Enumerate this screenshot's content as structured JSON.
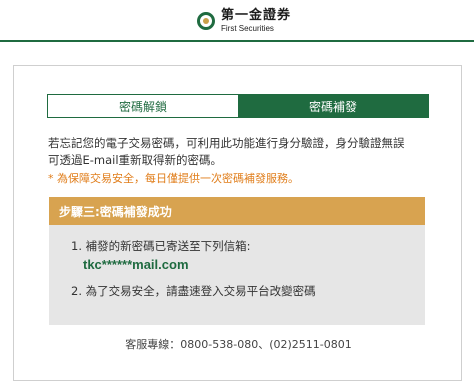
{
  "header": {
    "logo_cn": "第一金證券",
    "logo_en": "First Securities"
  },
  "tabs": [
    {
      "label": "密碼解鎖",
      "active": false
    },
    {
      "label": "密碼補發",
      "active": true
    }
  ],
  "intro": {
    "line1": "若忘記您的電子交易密碼，可利用此功能進行身分驗證，身分驗證無誤",
    "line2": "可透過E-mail重新取得新的密碼。"
  },
  "note": "* 為保障交易安全，每日僅提供一次密碼補發服務。",
  "step": {
    "title": "步驟三:密碼補發成功"
  },
  "result": {
    "line1": "1. 補發的新密碼已寄送至下列信箱:",
    "email": "tkc******mail.com",
    "line2": "2. 為了交易安全，請盡速登入交易平台改變密碼"
  },
  "footer": {
    "hotline": "客服專線：0800-538-080、(02)2511-0801"
  },
  "colors": {
    "brand_green": "#1f6b40",
    "step_bar": "#d8a350",
    "note_orange": "#e07d1a",
    "result_bg": "#e6e6e6"
  }
}
